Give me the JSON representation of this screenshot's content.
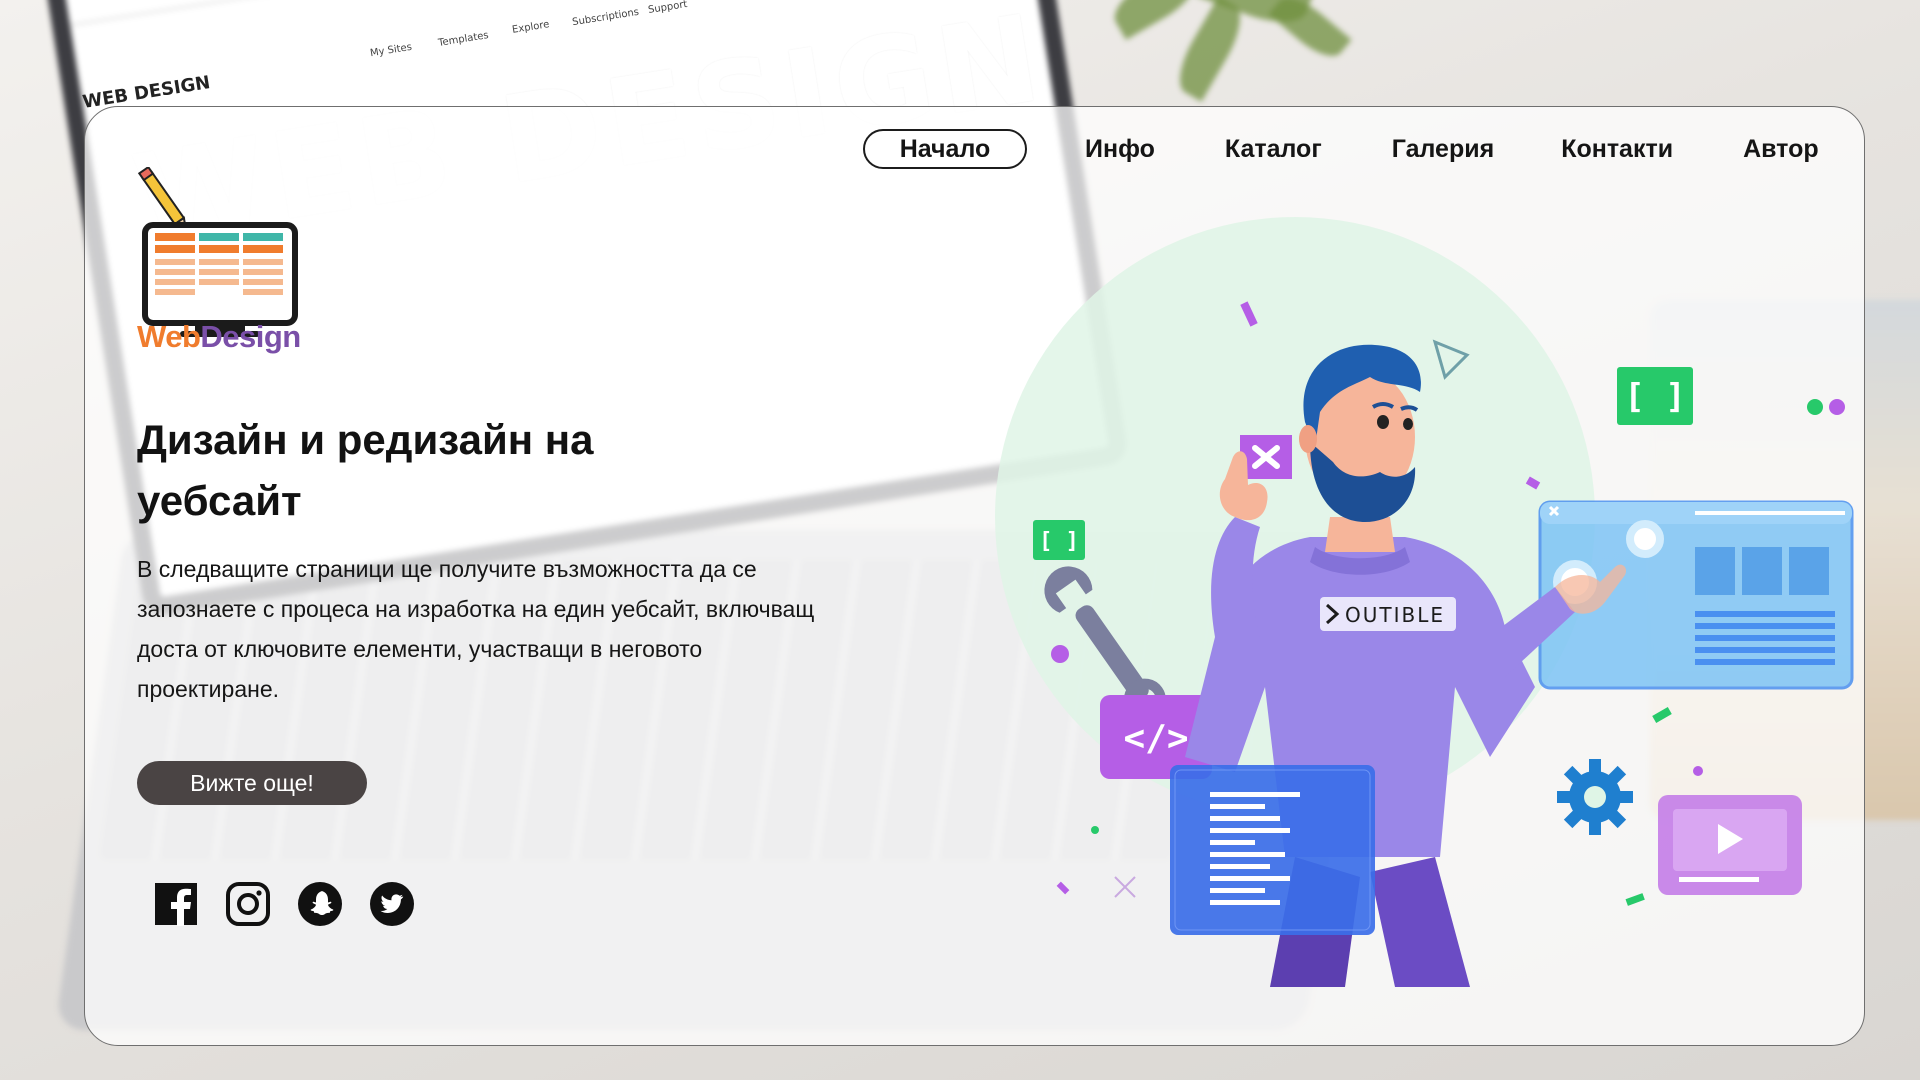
{
  "nav": {
    "items": [
      {
        "label": "Начало",
        "active": true
      },
      {
        "label": "Инфо",
        "active": false
      },
      {
        "label": "Каталог",
        "active": false
      },
      {
        "label": "Галерия",
        "active": false
      },
      {
        "label": "Контакти",
        "active": false
      },
      {
        "label": "Автор",
        "active": false
      }
    ]
  },
  "logo": {
    "word1": "Web",
    "word2": "Design",
    "color_web": "#f07c2d",
    "color_design": "#7a4fa8"
  },
  "hero": {
    "headline_line1": "Дизайн и редизайн на",
    "headline_line2": "уебсайт",
    "description": "В следващите страници ще получите възможността да се запознаете с процеса на изработка на един уебсайт, включващ доста от ключовите елементи, участващи в неговото проектиране.",
    "cta_label": "Вижте още!"
  },
  "social": [
    {
      "icon": "facebook-icon"
    },
    {
      "icon": "instagram-icon"
    },
    {
      "icon": "snapchat-icon"
    },
    {
      "icon": "twitter-icon"
    }
  ],
  "illustration": {
    "shirt_text": "OUTIBLE",
    "bracket_text": "[ ]",
    "code_tag_text": "</>"
  },
  "background": {
    "laptop_title": "WEB DESIGN",
    "laptop_brand": "WEB DESIGN",
    "laptop_nav": [
      "My Sites",
      "Templates",
      "Explore",
      "Subscriptions",
      "Support"
    ]
  },
  "colors": {
    "accent_purple": "#b55ee6",
    "accent_green": "#27c96a",
    "accent_blue": "#4a90f0",
    "cta_bg": "#4a4444"
  }
}
